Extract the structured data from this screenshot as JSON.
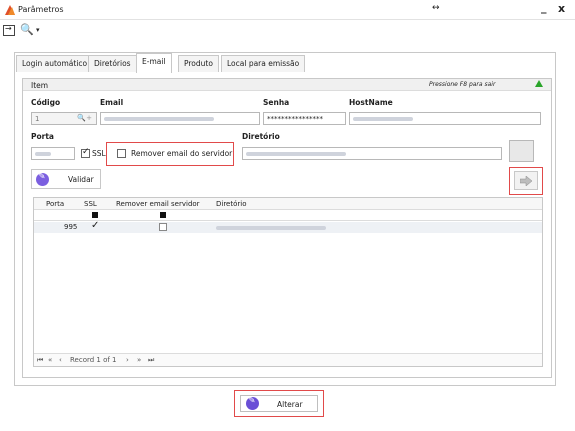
{
  "window": {
    "title": "Parâmetros",
    "resize_glyph": "↔",
    "min_glyph": "_",
    "close_glyph": "x"
  },
  "toolbar": {
    "search_dropdown": "▾"
  },
  "tabs": [
    "Login automático",
    "Diretórios",
    "E-mail",
    "Produto",
    "Local para emissão"
  ],
  "active_tab": "E-mail",
  "itembar": {
    "label": "Item",
    "hint": "Pressione F8 para sair"
  },
  "form": {
    "codigo_label": "Código",
    "codigo_value": "1",
    "email_label": "Email",
    "senha_label": "Senha",
    "senha_value": "****************",
    "hostname_label": "HostName",
    "porta_label": "Porta",
    "ssl_label": "SSL",
    "ssl_checked": true,
    "remover_label": "Remover email do servidor",
    "remover_checked": false,
    "diretorio_label": "Diretório"
  },
  "buttons": {
    "validar": "Validar",
    "alterar": "Alterar"
  },
  "grid": {
    "columns": [
      "Porta",
      "SSL",
      "Remover email servidor",
      "Diretório"
    ],
    "rows": [
      {
        "porta": "995",
        "ssl": true,
        "remover": false
      }
    ]
  },
  "navigator": {
    "first": "⏮",
    "prev_page": "«",
    "prev": "‹",
    "record_text": "Record 1 of 1",
    "next": "›",
    "next_page": "»",
    "last": "⏭"
  },
  "colors": {
    "highlight": "#e14a4a",
    "accent": "#6a4fd6",
    "ok_arrow": "#2aa52a"
  }
}
